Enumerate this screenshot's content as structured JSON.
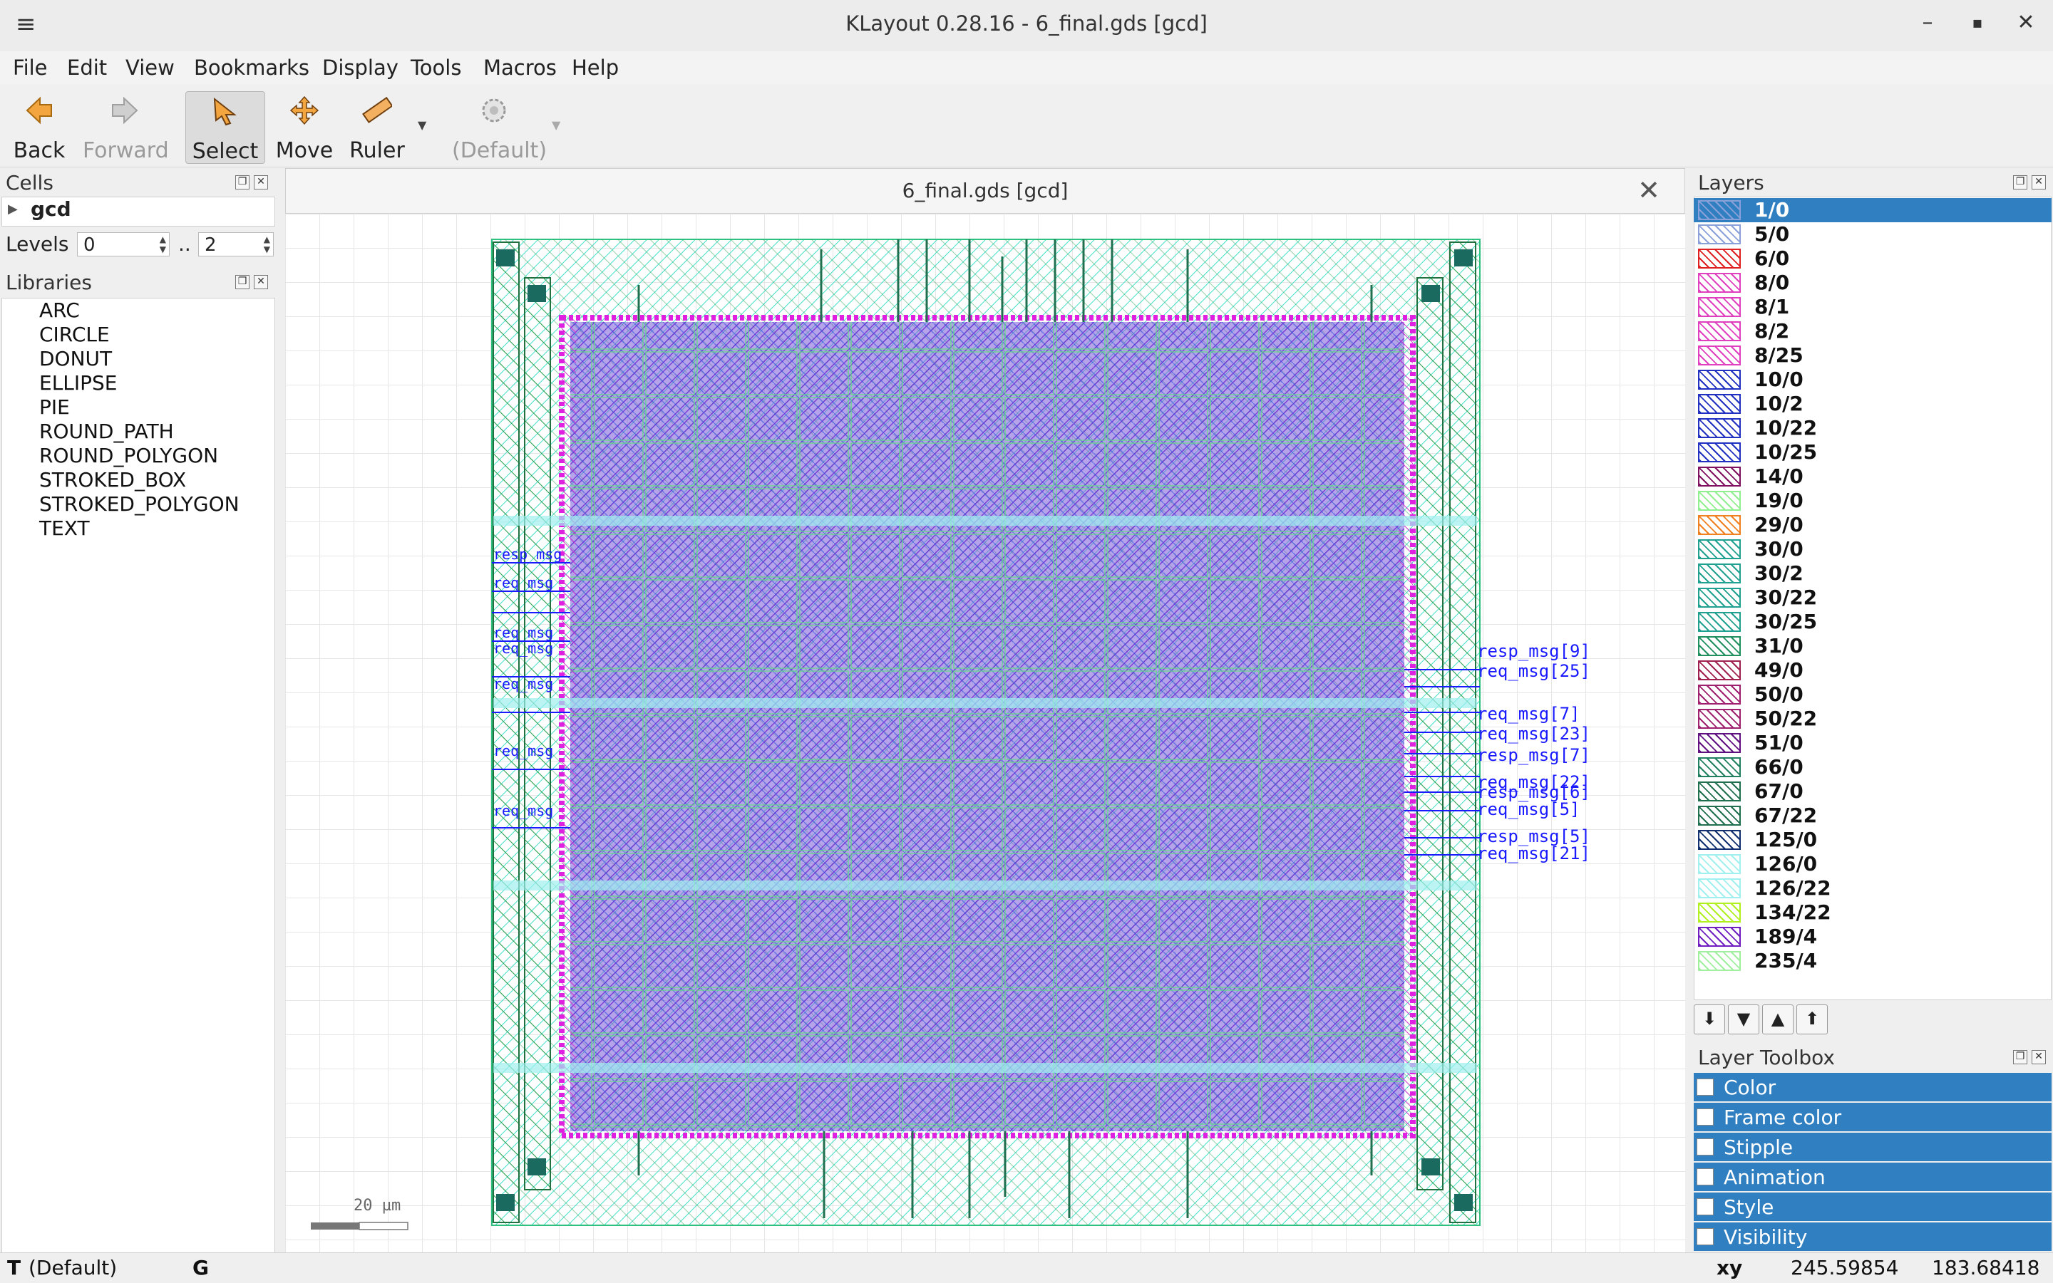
{
  "window": {
    "title": "KLayout 0.28.16 - 6_final.gds [gcd]",
    "menu_glyph": "≡",
    "min_glyph": "–",
    "max_glyph": "▪",
    "close_glyph": "✕"
  },
  "menu": [
    "File",
    "Edit",
    "View",
    "Bookmarks",
    "Display",
    "Tools",
    "Macros",
    "Help"
  ],
  "toolbar": {
    "back": "Back",
    "forward": "Forward",
    "select": "Select",
    "move": "Move",
    "ruler": "Ruler",
    "default": "(Default)"
  },
  "cells": {
    "title": "Cells",
    "top_cell": "gcd",
    "levels_label": "Levels",
    "levels_from": "0",
    "levels_sep": "..",
    "levels_to": "2"
  },
  "libraries": {
    "title": "Libraries",
    "items": [
      "ARC",
      "CIRCLE",
      "DONUT",
      "ELLIPSE",
      "PIE",
      "ROUND_PATH",
      "ROUND_POLYGON",
      "STROKED_BOX",
      "STROKED_POLYGON",
      "TEXT"
    ]
  },
  "canvas": {
    "tab_title": "6_final.gds [gcd]",
    "scale_label": "20 µm",
    "right_pin_labels": [
      "resp_msg[9]",
      "req_msg[25]",
      "req_msg[7]",
      "req_msg[23]",
      "resp_msg[7]",
      "req_msg[22]",
      "resp_msg[6]",
      "req_msg[5]",
      "resp_msg[5]",
      "req_msg[21]"
    ],
    "left_pin_labels": [
      "resp_msg",
      "req_msg",
      "req_msg",
      "req_msg",
      "req_msg",
      "req_msg",
      "req_msg"
    ]
  },
  "layers": {
    "title": "Layers",
    "items": [
      {
        "name": "1/0",
        "color": "#8aa0d8"
      },
      {
        "name": "5/0",
        "color": "#8aa0d8"
      },
      {
        "name": "6/0",
        "color": "#e02020"
      },
      {
        "name": "8/0",
        "color": "#e040c0"
      },
      {
        "name": "8/1",
        "color": "#e040c0"
      },
      {
        "name": "8/2",
        "color": "#e040c0"
      },
      {
        "name": "8/25",
        "color": "#e040c0"
      },
      {
        "name": "10/0",
        "color": "#2030c0"
      },
      {
        "name": "10/2",
        "color": "#2030c0"
      },
      {
        "name": "10/22",
        "color": "#2030c0"
      },
      {
        "name": "10/25",
        "color": "#2030c0"
      },
      {
        "name": "14/0",
        "color": "#801060"
      },
      {
        "name": "19/0",
        "color": "#90f090"
      },
      {
        "name": "29/0",
        "color": "#f08020"
      },
      {
        "name": "30/0",
        "color": "#20a090"
      },
      {
        "name": "30/2",
        "color": "#20a090"
      },
      {
        "name": "30/22",
        "color": "#20a090"
      },
      {
        "name": "30/25",
        "color": "#20a090"
      },
      {
        "name": "31/0",
        "color": "#209060"
      },
      {
        "name": "49/0",
        "color": "#a02050"
      },
      {
        "name": "50/0",
        "color": "#a02070"
      },
      {
        "name": "50/22",
        "color": "#a02070"
      },
      {
        "name": "51/0",
        "color": "#601080"
      },
      {
        "name": "66/0",
        "color": "#208060"
      },
      {
        "name": "67/0",
        "color": "#207050"
      },
      {
        "name": "67/22",
        "color": "#207050"
      },
      {
        "name": "125/0",
        "color": "#103070"
      },
      {
        "name": "126/0",
        "color": "#a0f0f0"
      },
      {
        "name": "126/22",
        "color": "#a0f0f0"
      },
      {
        "name": "134/22",
        "color": "#b0f020"
      },
      {
        "name": "189/4",
        "color": "#7020c0"
      },
      {
        "name": "235/4",
        "color": "#a0f0a0"
      }
    ]
  },
  "layer_buttons": [
    "⬇",
    "▼",
    "▲",
    "⬆"
  ],
  "toolbox": {
    "title": "Layer Toolbox",
    "items": [
      "Color",
      "Frame color",
      "Stipple",
      "Animation",
      "Style",
      "Visibility"
    ]
  },
  "status": {
    "mode_key": "T",
    "mode": "(Default)",
    "grid_key": "G",
    "coord_label": "xy",
    "x": "245.59854",
    "y": "183.68418"
  }
}
